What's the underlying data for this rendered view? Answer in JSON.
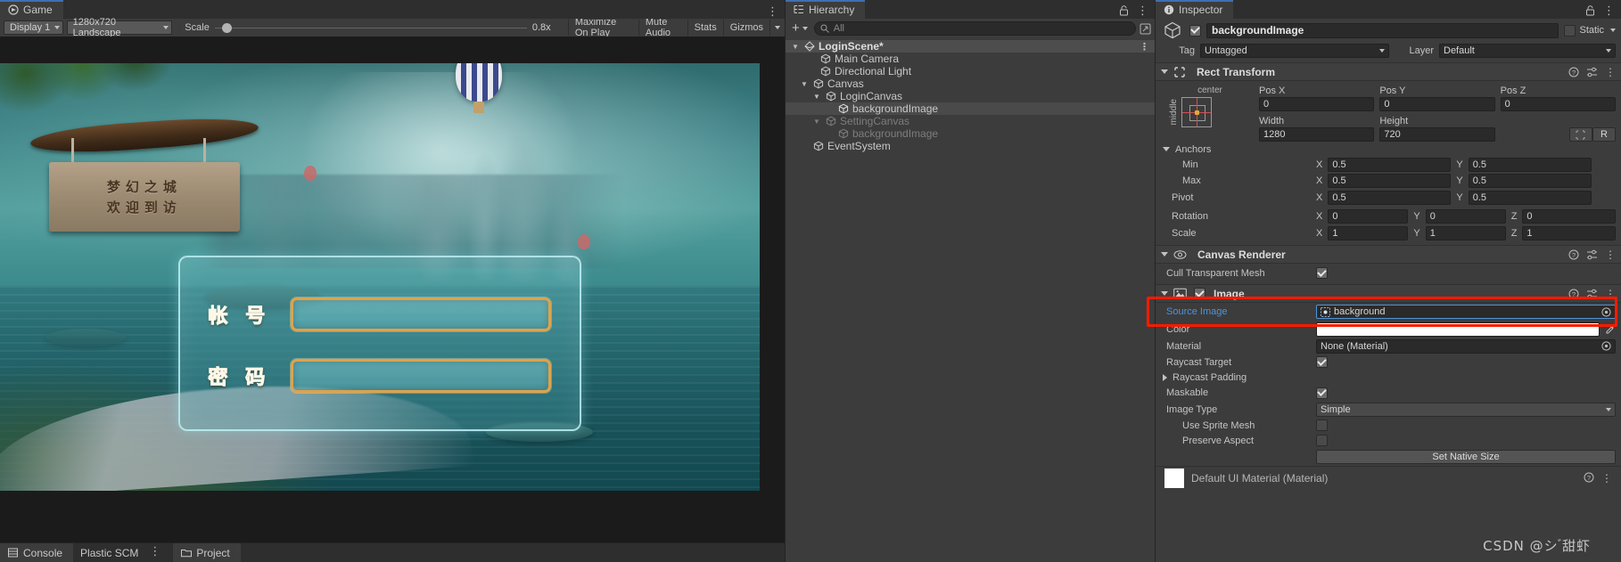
{
  "game": {
    "tab_label": "Game",
    "display": "Display 1",
    "resolution": "1280x720 Landscape",
    "scale_label": "Scale",
    "scale_value": "0.8x",
    "maximize_on_play": "Maximize On Play",
    "mute_audio": "Mute Audio",
    "stats": "Stats",
    "gizmos": "Gizmos",
    "scene_content": {
      "sign_line1": "梦幻之城",
      "sign_line2": "欢迎到访",
      "account_label": "帐 号",
      "password_label": "密 码",
      "account_value": "",
      "password_value": ""
    }
  },
  "bottom_tabs": [
    {
      "label": "Console",
      "icon": "console-icon"
    },
    {
      "label": "Plastic SCM",
      "icon": ""
    },
    {
      "label": "Project",
      "icon": "folder-icon"
    }
  ],
  "hierarchy": {
    "tab_label": "Hierarchy",
    "search_placeholder": "All",
    "search_value": "",
    "nodes": [
      {
        "label": "LoginScene*",
        "depth": 0,
        "expanded": true,
        "type": "scene",
        "selected": false,
        "faded": false,
        "kebab": true
      },
      {
        "label": "Main Camera",
        "depth": 1,
        "expanded": null,
        "type": "go",
        "selected": false,
        "faded": false,
        "kebab": false
      },
      {
        "label": "Directional Light",
        "depth": 1,
        "expanded": null,
        "type": "go",
        "selected": false,
        "faded": false,
        "kebab": false
      },
      {
        "label": "Canvas",
        "depth": 1,
        "expanded": true,
        "type": "go",
        "selected": false,
        "faded": false,
        "kebab": false
      },
      {
        "label": "LoginCanvas",
        "depth": 2,
        "expanded": true,
        "type": "go",
        "selected": false,
        "faded": false,
        "kebab": false
      },
      {
        "label": "backgroundImage",
        "depth": 3,
        "expanded": null,
        "type": "go",
        "selected": true,
        "faded": false,
        "kebab": false
      },
      {
        "label": "SettingCanvas",
        "depth": 2,
        "expanded": true,
        "type": "go",
        "selected": false,
        "faded": true,
        "kebab": false
      },
      {
        "label": "backgroundImage",
        "depth": 3,
        "expanded": null,
        "type": "go",
        "selected": false,
        "faded": true,
        "kebab": false
      },
      {
        "label": "EventSystem",
        "depth": 1,
        "expanded": null,
        "type": "go",
        "selected": false,
        "faded": false,
        "kebab": false
      }
    ]
  },
  "inspector": {
    "tab_label": "Inspector",
    "object_name": "backgroundImage",
    "enabled": true,
    "static_label": "Static",
    "tag_label": "Tag",
    "tag_value": "Untagged",
    "layer_label": "Layer",
    "layer_value": "Default",
    "rect_transform": {
      "title": "Rect Transform",
      "anchor_preset_h": "center",
      "anchor_preset_v": "middle",
      "pos_x_label": "Pos X",
      "pos_x": "0",
      "pos_y_label": "Pos Y",
      "pos_y": "0",
      "pos_z_label": "Pos Z",
      "pos_z": "0",
      "width_label": "Width",
      "width": "1280",
      "height_label": "Height",
      "height": "720",
      "blueprint_label": "R",
      "anchors_label": "Anchors",
      "min_label": "Min",
      "min_x": "0.5",
      "min_y": "0.5",
      "max_label": "Max",
      "max_x": "0.5",
      "max_y": "0.5",
      "pivot_label": "Pivot",
      "pivot_x": "0.5",
      "pivot_y": "0.5",
      "rotation_label": "Rotation",
      "rot_x": "0",
      "rot_y": "0",
      "rot_z": "0",
      "scale_label": "Scale",
      "scale_x": "1",
      "scale_y": "1",
      "scale_z": "1"
    },
    "canvas_renderer": {
      "title": "Canvas Renderer",
      "cull_label": "Cull Transparent Mesh",
      "cull_checked": true
    },
    "image": {
      "title": "Image",
      "enabled": true,
      "source_image_label": "Source Image",
      "source_image_value": "background",
      "color_label": "Color",
      "color_value": "#FFFFFF",
      "material_label": "Material",
      "material_value": "None (Material)",
      "raycast_target_label": "Raycast Target",
      "raycast_target_checked": true,
      "raycast_padding_label": "Raycast Padding",
      "maskable_label": "Maskable",
      "maskable_checked": true,
      "image_type_label": "Image Type",
      "image_type_value": "Simple",
      "use_sprite_mesh_label": "Use Sprite Mesh",
      "use_sprite_mesh_checked": false,
      "preserve_aspect_label": "Preserve Aspect",
      "preserve_aspect_checked": false,
      "set_native_size_label": "Set Native Size"
    },
    "material_footer": {
      "label": "Default UI Material (Material)"
    },
    "highlight_color": "#ff1a00"
  },
  "watermark": "CSDN @シ ゙甜虾"
}
